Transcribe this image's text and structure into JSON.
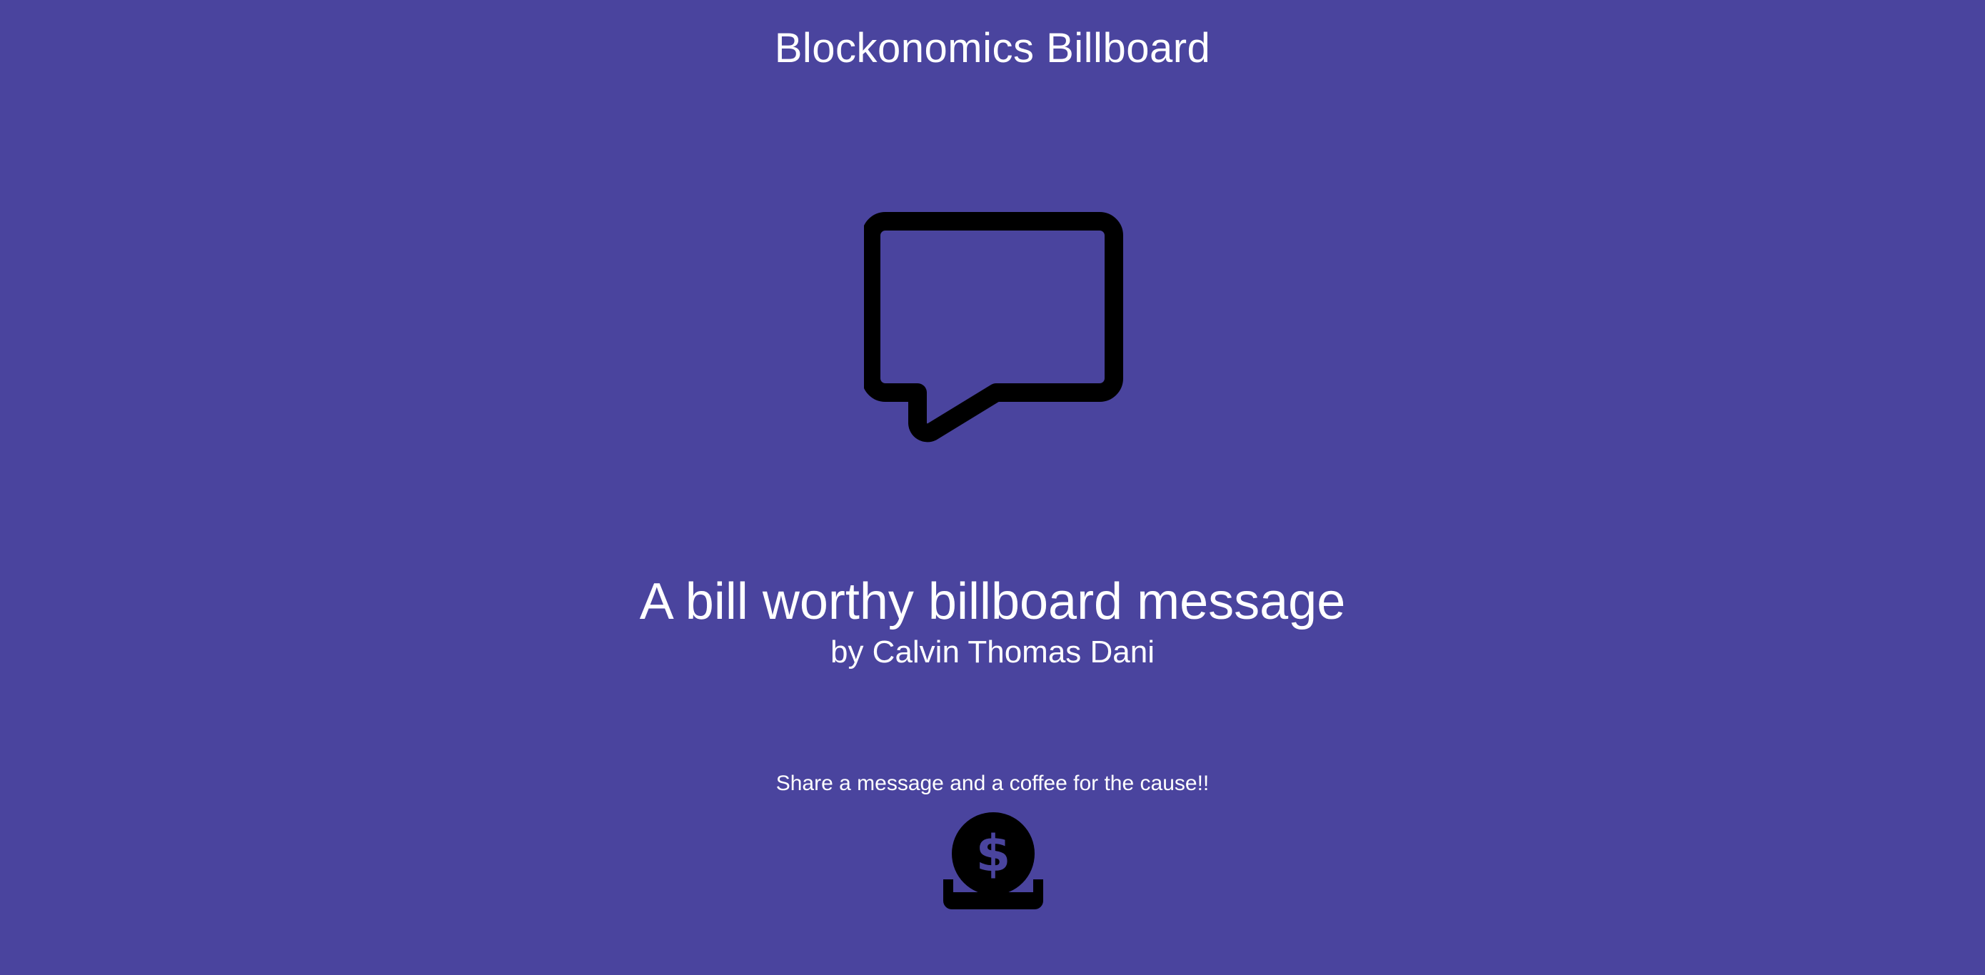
{
  "app": {
    "title": "Blockonomics Billboard"
  },
  "billboard": {
    "icon": "chat-bubble-icon",
    "message": "A bill worthy billboard message",
    "author": "by Calvin Thomas Dani"
  },
  "cta": {
    "text": "Share a message and a coffee for the cause!!",
    "button_icon": "donate-coin-icon"
  },
  "colors": {
    "background": "#4a449e",
    "text": "#ffffff",
    "icon": "#000000"
  }
}
